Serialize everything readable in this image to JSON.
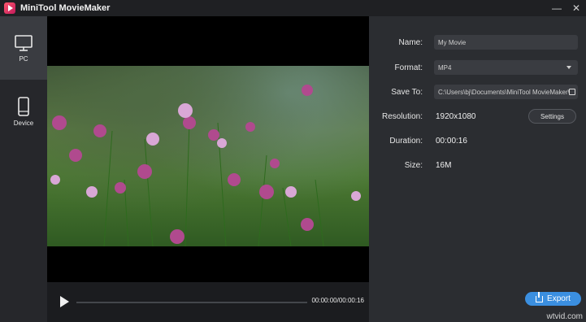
{
  "window": {
    "title": "MiniTool MovieMaker"
  },
  "sidebar": {
    "items": [
      {
        "label": "PC",
        "icon": "monitor-icon",
        "active": true
      },
      {
        "label": "Device",
        "icon": "phone-icon",
        "active": false
      }
    ]
  },
  "player": {
    "timecode": "00:00:00/00:00:16"
  },
  "form": {
    "name": {
      "label": "Name:",
      "value": "My Movie"
    },
    "format": {
      "label": "Format:",
      "value": "MP4"
    },
    "save_to": {
      "label": "Save To:",
      "value": "C:\\Users\\bj\\Documents\\MiniTool MovieMaker\\"
    },
    "resolution": {
      "label": "Resolution:",
      "value": "1920x1080",
      "settings_label": "Settings"
    },
    "duration": {
      "label": "Duration:",
      "value": "00:00:16"
    },
    "size": {
      "label": "Size:",
      "value": "16M"
    }
  },
  "export": {
    "label": "Export"
  },
  "watermark": "wtvid.com",
  "colors": {
    "accent": "#3b8fe0"
  }
}
